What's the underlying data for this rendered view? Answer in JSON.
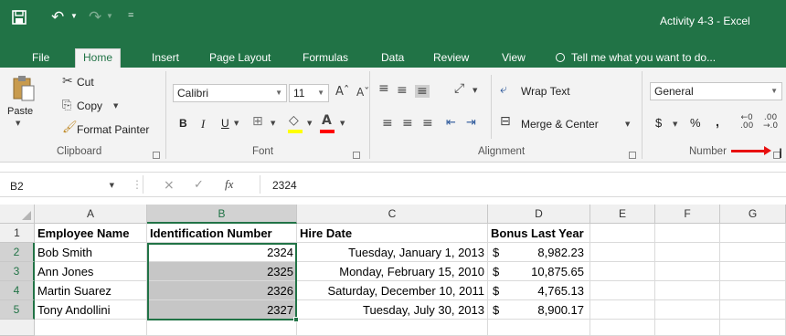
{
  "window": {
    "title": "Activity 4-3 - Excel",
    "qat_more": "="
  },
  "tabs": [
    {
      "label": "File"
    },
    {
      "label": "Home"
    },
    {
      "label": "Insert"
    },
    {
      "label": "Page Layout"
    },
    {
      "label": "Formulas"
    },
    {
      "label": "Data"
    },
    {
      "label": "Review"
    },
    {
      "label": "View"
    }
  ],
  "tell_me": "Tell me what you want to do...",
  "ribbon": {
    "clipboard": {
      "paste": "Paste",
      "cut": "Cut",
      "copy": "Copy",
      "format_painter": "Format Painter",
      "label": "Clipboard"
    },
    "font": {
      "family": "Calibri",
      "size": "11",
      "bold": "B",
      "italic": "I",
      "underline": "U",
      "label": "Font"
    },
    "alignment": {
      "wrap_text": "Wrap Text",
      "merge_center": "Merge & Center",
      "label": "Alignment"
    },
    "number": {
      "format": "General",
      "currency": "$",
      "percent": "%",
      "comma": ",",
      "label": "Number"
    }
  },
  "formula_bar": {
    "name_box": "B2",
    "fx": "fx",
    "value": "2324"
  },
  "sheet": {
    "columns": [
      "A",
      "B",
      "C",
      "D",
      "E",
      "F",
      "G"
    ],
    "rows": [
      "1",
      "2",
      "3",
      "4",
      "5"
    ],
    "header": {
      "a": "Employee Name",
      "b": "Identification Number",
      "c": "Hire Date",
      "d": "Bonus Last Year"
    },
    "data": [
      {
        "name": "Bob Smith",
        "id": "2324",
        "hire": "Tuesday, January 1, 2013",
        "bonus_symbol": "$",
        "bonus": "8,982.23"
      },
      {
        "name": "Ann Jones",
        "id": "2325",
        "hire": "Monday, February 15, 2010",
        "bonus_symbol": "$",
        "bonus": "10,875.65"
      },
      {
        "name": "Martin Suarez",
        "id": "2326",
        "hire": "Saturday, December 10, 2011",
        "bonus_symbol": "$",
        "bonus": "4,765.13"
      },
      {
        "name": "Tony Andollini",
        "id": "2327",
        "hire": "Tuesday, July 30, 2013",
        "bonus_symbol": "$",
        "bonus": "8,900.17"
      }
    ]
  },
  "colors": {
    "excel_green": "#217346",
    "annotation_arrow": "#e81010",
    "selection_fill": "#c6c6c6"
  }
}
